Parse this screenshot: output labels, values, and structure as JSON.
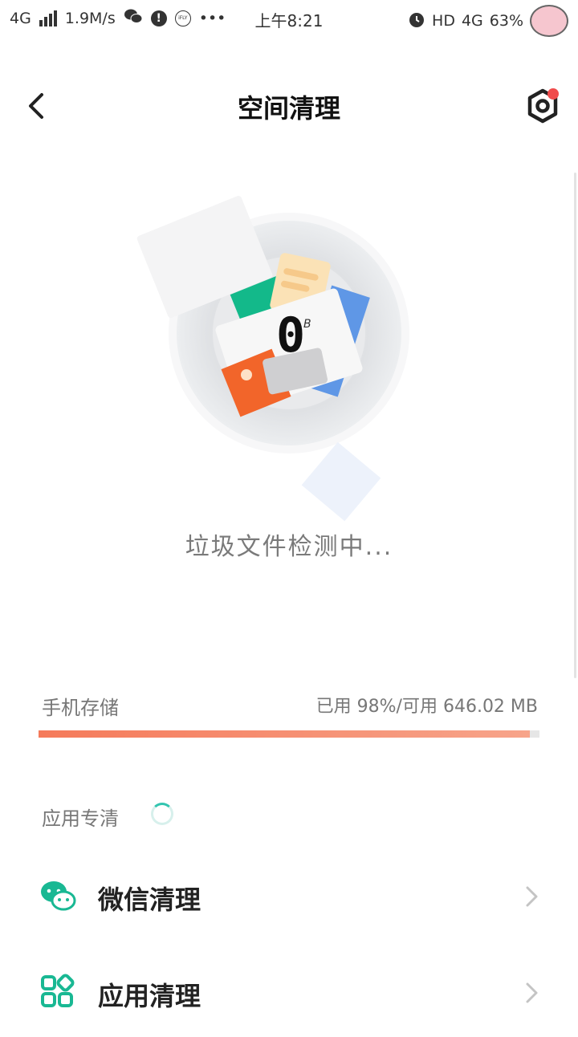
{
  "status_bar": {
    "network_left": "4G",
    "speed": "1.9M/s",
    "alert_icon": "!",
    "ifly_text": "iFLY",
    "more": "•••",
    "time": "上午8:21",
    "hd": "HD",
    "network_right": "4G",
    "battery": "63%"
  },
  "header": {
    "title": "空间清理"
  },
  "scan": {
    "size_value": "0",
    "size_unit": "B",
    "status_text": "垃圾文件检测中..."
  },
  "storage": {
    "label": "手机存储",
    "usage_text": "已用 98%/可用 646.02 MB",
    "used_fraction": 0.98
  },
  "apps_section": {
    "label": "应用专清"
  },
  "list": [
    {
      "label": "微信清理",
      "icon": "wechat-icon"
    },
    {
      "label": "应用清理",
      "icon": "apps-grid-icon"
    }
  ],
  "colors": {
    "accent": "#33c5b0",
    "storage_bar": "#f57a5a",
    "notification_dot": "#f04b4b"
  }
}
